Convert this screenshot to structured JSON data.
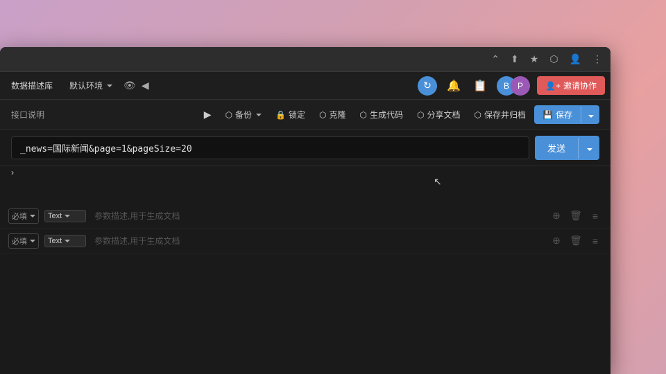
{
  "browser": {
    "topbar": {
      "icons": [
        "share-icon",
        "bookmark-icon",
        "puzzle-icon",
        "profile-icon",
        "more-icon"
      ]
    },
    "minimize_label": "−"
  },
  "app_toolbar": {
    "db_label": "数据描述库",
    "env_label": "默认环境",
    "env_arrow": "▾",
    "eye_icon": "👁",
    "back_icon": "◀"
  },
  "toolbar_right": {
    "sync_icon": "↻",
    "bell_icon": "🔔",
    "doc_icon": "📄",
    "avatar1_initial": "B",
    "avatar2_initial": "P",
    "invite_label": "邀请协作"
  },
  "action_toolbar": {
    "label": "接口说明",
    "play_icon": "▶",
    "backup_label": "备份",
    "backup_arrow": "▾",
    "lock_label": "锁定",
    "clone_label": "克隆",
    "generate_code_label": "生成代码",
    "share_doc_label": "分享文档",
    "save_archive_label": "保存并归档",
    "save_label": "保存",
    "save_arrow": "▾",
    "cursor_icon": "⊞"
  },
  "url_bar": {
    "value": "_news=国际新闻&page=1&pageSize=20",
    "send_label": "发送",
    "send_arrow": "▾"
  },
  "cursor": {
    "indicator": ">"
  },
  "params": {
    "rows": [
      {
        "required_label": "必填",
        "required_arrow": "▾",
        "type_label": "Text",
        "type_arrow": "▾",
        "placeholder": "参数描述,用于生成文档"
      },
      {
        "required_label": "必填",
        "required_arrow": "▾",
        "type_label": "Text",
        "type_arrow": "▾",
        "placeholder": "参数描述,用于生成文档"
      }
    ]
  },
  "colors": {
    "accent_blue": "#4a90d9",
    "accent_red": "#e05a5a",
    "bg_dark": "#1a1a1a",
    "bg_medium": "#1e1e1e",
    "text_dim": "#999",
    "border": "#333"
  }
}
